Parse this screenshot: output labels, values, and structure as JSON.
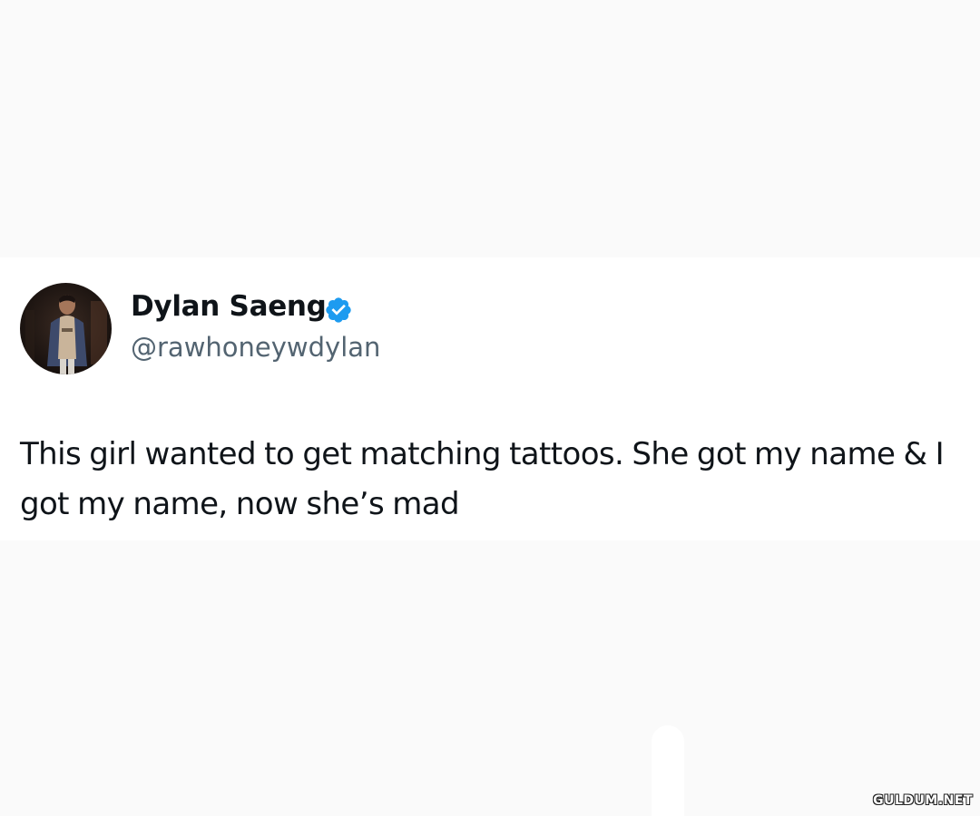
{
  "tweet": {
    "author": {
      "display_name": "Dylan Saeng",
      "handle": "@rawhoneywdylan",
      "verified": true,
      "avatar_icon": "profile-photo",
      "verified_icon": "verified-badge-icon",
      "verified_color": "#1d9bf0"
    },
    "text": "This girl wanted to get matching tattoos. She got my name & I got my name, now she’s mad"
  },
  "watermark": {
    "text": "GULDUM.NET"
  },
  "colors": {
    "background": "#fafafa",
    "card": "#ffffff",
    "name_text": "#0f1419",
    "handle_text": "#536471"
  }
}
